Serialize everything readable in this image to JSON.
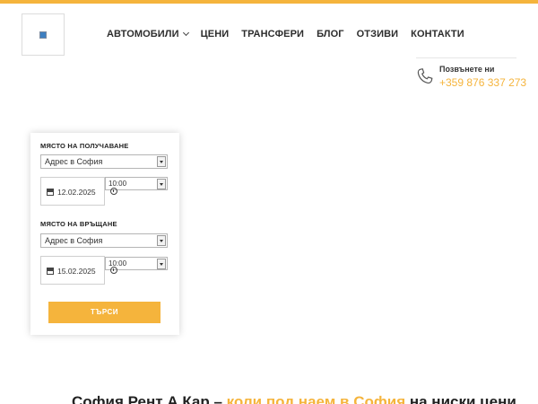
{
  "nav": {
    "items": [
      {
        "label": "АВТОМОБИЛИ",
        "has_dropdown": true
      },
      {
        "label": "ЦЕНИ"
      },
      {
        "label": "ТРАНСФЕРИ"
      },
      {
        "label": "БЛОГ"
      },
      {
        "label": "ОТЗИВИ"
      },
      {
        "label": "КОНТАКТИ"
      }
    ]
  },
  "call": {
    "label": "Позвънете ни",
    "phone": "+359 876 337 273",
    "icon": "phone-icon"
  },
  "booking": {
    "pickup": {
      "label": "МЯСТО НА ПОЛУЧАВАНЕ",
      "location": "Адрес в София",
      "date": "12.02.2025",
      "time": "10:00"
    },
    "return": {
      "label": "МЯСТО НА ВРЪЩАНЕ",
      "location": "Адрес в София",
      "date": "15.02.2025",
      "time": "10:00"
    },
    "search_label": "ТЪРСИ"
  },
  "bottom": {
    "part1": "София Рент А Кар – ",
    "part2": "коли под наем в София",
    "part3": " на ниски цени"
  },
  "colors": {
    "accent": "#f5b43c",
    "text": "#2d2d2d"
  }
}
